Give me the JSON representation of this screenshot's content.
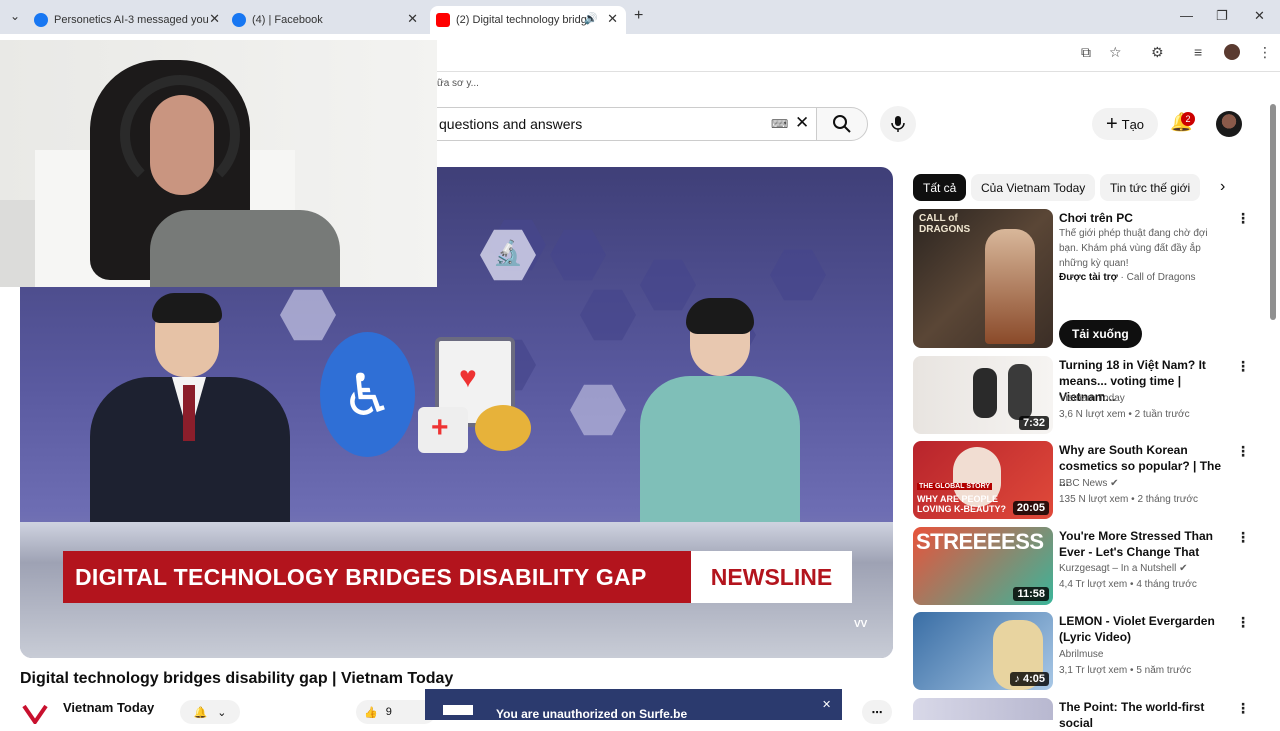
{
  "browser": {
    "tabs": [
      {
        "label": "Personetics AI-3 messaged you",
        "active": false
      },
      {
        "label": "(4) | Facebook",
        "active": false
      },
      {
        "label": "(2) Digital technology bridg",
        "active": true
      }
    ],
    "bookmark_hint": "ữa sơ y..."
  },
  "header": {
    "search_value": "questions and answers",
    "create_label": "Tạo",
    "notif_count": "2"
  },
  "video": {
    "lowerthird_text": "DIGITAL TECHNOLOGY BRIDGES DISABILITY GAP",
    "lowerthird_brand": "NEWSLINE",
    "title": "Digital technology bridges disability gap | Vietnam Today",
    "channel": "Vietnam Today",
    "like_count": "9"
  },
  "banner": {
    "text": "You are unauthorized on Surfe.be"
  },
  "sidebar": {
    "chips": [
      "Tất cả",
      "Của Vietnam Today",
      "Tin tức thế giới"
    ],
    "ad": {
      "title": "Chơi trên PC",
      "desc": "Thế giới phép thuật đang chờ đợi bạn. Khám phá vùng đất đầy ắp những kỳ quan!",
      "sponsored": "Được tài trợ",
      "advertiser": "Call of Dragons",
      "cta": "Tải xuống",
      "thumb_text": "CALL of DRAGONS"
    },
    "videos": [
      {
        "title": "Turning 18 in Việt Nam? It means... voting time | Vietnam...",
        "channel": "Vietnam Today",
        "stats": "3,6 N lượt xem • 2 tuần trước",
        "duration": "7:32",
        "verified": false
      },
      {
        "title": "Why are South Korean cosmetics so popular? | The ...",
        "channel": "BBC News",
        "stats": "135 N lượt xem • 2 tháng trước",
        "duration": "20:05",
        "verified": true,
        "thumb_tag": "THE GLOBAL STORY",
        "thumb_text": "WHY ARE PEOPLE LOVING K-BEAUTY?"
      },
      {
        "title": "You're More Stressed Than Ever - Let's Change That",
        "channel": "Kurzgesagt – In a Nutshell",
        "stats": "4,4 Tr lượt xem • 4 tháng trước",
        "duration": "11:58",
        "verified": true,
        "thumb_text": "STREEEESS"
      },
      {
        "title": "LEMON - Violet Evergarden (Lyric Video)",
        "channel": "Abrilmuse",
        "stats": "3,1 Tr lượt xem • 5 năm trước",
        "duration": "4:05",
        "verified": false
      },
      {
        "title": "The Point: The world-first social",
        "channel": "",
        "stats": "",
        "duration": "",
        "verified": false
      }
    ]
  },
  "colors": {
    "youtube_red": "#cc0000",
    "lowerthird_red": "#b3141d",
    "surfe_blue": "#2b3a6e"
  }
}
